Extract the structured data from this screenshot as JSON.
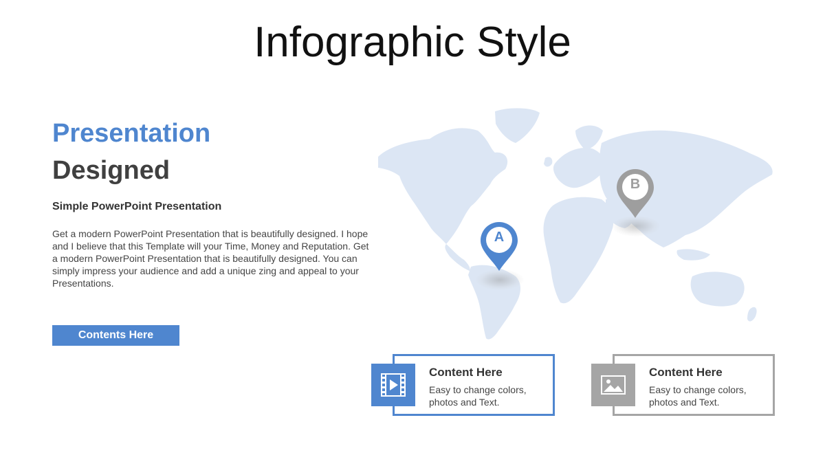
{
  "slide": {
    "title": "Infographic Style"
  },
  "left": {
    "heading_blue": "Presentation",
    "heading_dark": "Designed",
    "subheading": "Simple PowerPoint Presentation",
    "body": "Get a modern PowerPoint  Presentation that is beautifully designed. I hope and I believe that this Template will your Time, Money and Reputation. Get a modern PowerPoint  Presentation that is beautifully designed. You can simply impress your audience and add a unique zing and appeal to your Presentations.",
    "button_label": "Contents Here"
  },
  "map": {
    "pins": [
      {
        "label": "A",
        "color": "#4f86cf"
      },
      {
        "label": "B",
        "color": "#9e9e9e"
      }
    ],
    "land_color": "#dce6f4"
  },
  "cards": [
    {
      "title": "Content  Here",
      "description": "Easy to change colors, photos and Text.",
      "icon": "video-icon",
      "color": "#4f86cf"
    },
    {
      "title": "Content  Here",
      "description": "Easy to change colors, photos and Text.",
      "icon": "image-icon",
      "color": "#a5a5a5"
    }
  ],
  "colors": {
    "accent_blue": "#4f86cf",
    "accent_gray": "#a5a5a5",
    "text_dark": "#404040"
  }
}
